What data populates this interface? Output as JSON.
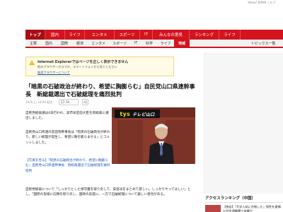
{
  "header": {
    "util_links": [
      "Yahoo! JAPAN ヘルプ"
    ],
    "colors": {
      "brand_red": "#d3141d",
      "active_tab": "#a90d14"
    }
  },
  "nav_primary": {
    "tabs": [
      "トップ",
      "国内",
      "ライフ",
      "エンタメ",
      "スポーツ",
      "IT",
      "みんなの意見",
      "ランキング",
      "ライフ"
    ],
    "active_index": 0
  },
  "nav_secondary": {
    "tabs": [
      "主要",
      "国内",
      "国際",
      "経済",
      "エンタメ",
      "スポーツ",
      "IT",
      "科学",
      "ライフ",
      "地域",
      "トピックス一覧"
    ],
    "active_index": 9
  },
  "notice": {
    "icon": "warning-icon",
    "title": "Internet Explorerではページを正しく表示できません",
    "subtitle": "他のブラウザーかスマホ、スマートフォンから見てください",
    "link": "推奨ブラウザーについて"
  },
  "article": {
    "headline": "「暗黒の石破政治が終わり、希望に胸膨らむ」自民党山口県連幹事長　新総裁選出で石破総理を痛烈批判",
    "date": "10/4(土) 18:00 配信",
    "comment_count": "33",
    "share_icon": "share-icon",
    "paragraphs": [
      "自民党総裁選は4日行われ、高市早苗前大臣を新総裁に選出しました。",
      "自民党山口県連の友田有幹事長は「暗黒の石破政治が終わり、新しい総理が誕生し、希望に胸を膨らませる」とコメントしました。"
    ],
    "link_text": "【写真を見る】「暗黒の石破政治が終わり、希望に胸膨らむ」自民党山口県連幹事長　新総裁選出で石破総理を痛烈批判",
    "long_paragraph": "自民党総裁について「しっかりとした保守層を取り戻して、安倍派をまとめて欲しい。しっかりやってほしい」とし、「国民の皆様に信頼を取り戻し、国政の前進に、一方で石破総理について厳しい意見がある。",
    "photo_caption_logo": "tys",
    "photo_caption_sub": "テレビ山口"
  },
  "ranking": {
    "title": "アクセスランキング（中国）",
    "items": [
      {
        "rank": "1",
        "text": "【独自】『大学入試に合格した』男性を逮捕 公共交通機関で盗撮か"
      }
    ]
  }
}
